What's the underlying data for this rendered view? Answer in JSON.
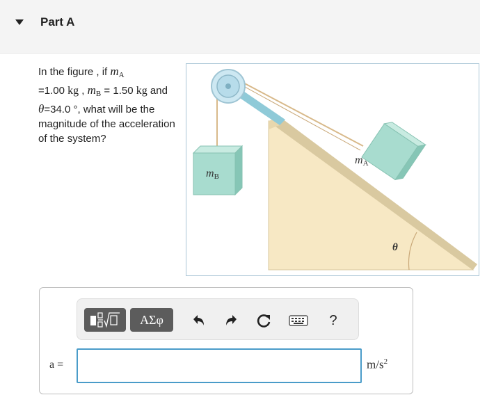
{
  "part": {
    "title": "Part A"
  },
  "question": {
    "t1": "In the figure , if ",
    "mA_sym": "m",
    "mA_sub": "A",
    "t2": "=1.00 ",
    "kg1": "kg",
    "t3": " , ",
    "mB_sym": "m",
    "mB_sub": "B",
    "t4": " = 1.50 ",
    "kg2": "kg",
    "t5": " and ",
    "theta": "θ",
    "t6": "=34.0 °, what will be the magnitude of the acceleration of the system?"
  },
  "figure": {
    "block_b_label": "mB",
    "block_a_label": "mA",
    "angle_label": "θ",
    "colors": {
      "incline": "#f7e8c4",
      "incline_top": "#d9c9a0",
      "block": "#a8dccf",
      "pulley": "#b7dcea",
      "rope": "#d8b98a"
    }
  },
  "toolbar": {
    "templates_icon": "fraction-radical-icon",
    "symbols_label": "ΑΣφ",
    "undo_icon": "undo-icon",
    "redo_icon": "redo-icon",
    "reset_icon": "reset-icon",
    "keyboard_icon": "keyboard-icon",
    "help_label": "?"
  },
  "answer": {
    "label": "a =",
    "value": "",
    "units_base": "m/s",
    "units_exp": "2"
  }
}
